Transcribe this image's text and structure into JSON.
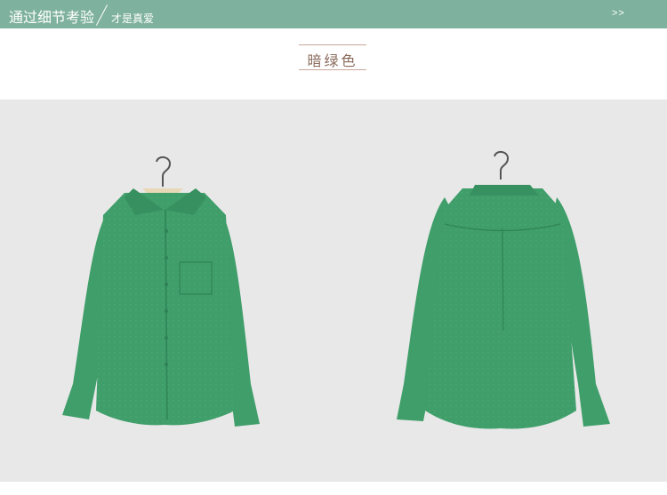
{
  "banner": {
    "title": "通过细节考验",
    "subtitle": "才是真爱",
    "more": ">>"
  },
  "color_label": "暗绿色",
  "colors": {
    "banner_bg": "#7fb29e",
    "label_text": "#8a6b5c",
    "photo_bg": "#e8e8e8",
    "shirt": "#3f9e6a",
    "shirt_shadow": "#2f8356"
  },
  "photo": {
    "items": [
      {
        "view": "front",
        "icon": "shirt-front-icon"
      },
      {
        "view": "back",
        "icon": "shirt-back-icon"
      }
    ]
  }
}
